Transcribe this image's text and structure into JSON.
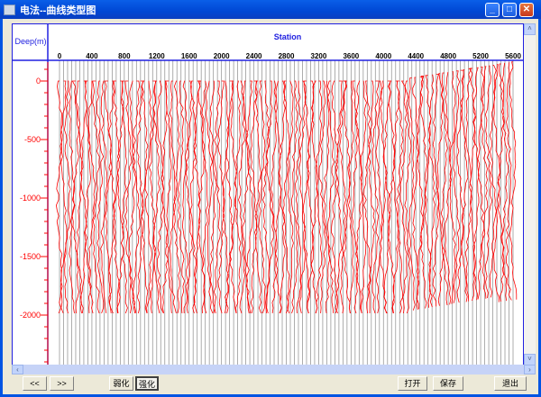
{
  "window": {
    "title": "电法--曲线类型图",
    "minimize": "_",
    "maximize": "□",
    "close": "✕"
  },
  "chart_data": {
    "type": "line",
    "title": "Station",
    "ylabel": "Deep(m)",
    "x_ticks": [
      "0",
      "400",
      "800",
      "1200",
      "1600",
      "2000",
      "2400",
      "2800",
      "3200",
      "3600",
      "4000",
      "4400",
      "4800",
      "5200",
      "5600"
    ],
    "y_ticks": [
      "0",
      "-500",
      "-1000",
      "-1500",
      "-2000"
    ],
    "xlim": [
      0,
      5600
    ],
    "ylim": [
      -2000,
      0
    ],
    "trace_spacing": 50,
    "trace_color": "#ff0000",
    "baseline_color": "#999999"
  },
  "scroll": {
    "up": "˄",
    "down": "˅",
    "left": "‹",
    "right": "›"
  },
  "buttons": {
    "prev": "<<",
    "next": ">>",
    "weaken": "弱化",
    "strengthen": "强化",
    "open": "打开",
    "save": "保存",
    "exit": "退出"
  }
}
